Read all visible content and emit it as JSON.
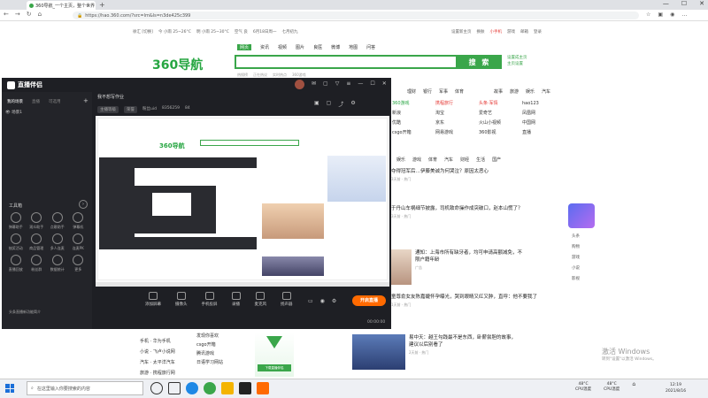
{
  "browser": {
    "tab_title": "360导航_一个主页，整个世界",
    "url": "https://hao.360.com/?src=lm&ls=n3de425c399",
    "window_controls": [
      "—",
      "☐",
      "✕"
    ]
  },
  "hao360": {
    "info_left": [
      "徐汇 [切换]",
      "今 小雨 25~26°C",
      "明 小雨 25~30°C",
      "空气 良",
      "6月18日周一",
      "七月初九"
    ],
    "info_right": [
      "设置新主页",
      "换肤",
      "小手机",
      "游戏",
      "邮箱",
      "登录"
    ],
    "logo": "360导航",
    "search_tabs": [
      "网页",
      "资讯",
      "视频",
      "图片",
      "良医",
      "微博",
      "地图",
      "问答"
    ],
    "search_button": "搜 索",
    "search_links": [
      "设置成主页",
      "主页设置"
    ],
    "hot_links": [
      "热搜榜",
      "正在热议",
      "实时热点",
      "360游戏"
    ],
    "top_nav_left": [
      "理财",
      "银行",
      "军事",
      "体育"
    ],
    "top_nav_right": [
      "故事",
      "旅游",
      "娱乐",
      "汽车"
    ],
    "site_grid": [
      "360游戏",
      "携程旅行",
      "头条·军情",
      "hao123",
      "新浪",
      "淘宝",
      "爱奇艺",
      "凤凰网",
      "优酷",
      "京东",
      "火山小视频",
      "中国网",
      "csgo开箱",
      "网易游戏",
      "360影视",
      "直播",
      "今日看点",
      "游戏·小游戏",
      "日语学习网站",
      "懂车帝"
    ],
    "side_r": [
      "4399",
      "网易游戏",
      "今日看点"
    ],
    "news_tabs": [
      "娱乐",
      "游戏",
      "体育",
      "汽车",
      "财经",
      "生活",
      "国产"
    ],
    "news": [
      {
        "title": "夺得冠军后…伊藤美诚为何哭泣？原因太恶心",
        "meta": "3天前 · 热门"
      },
      {
        "title": "于丹山车祸细节披露，司机致命操作成突破口，赵本山慌了？",
        "meta": "3天前 · 热门"
      },
      {
        "title": "通知：上海市所有缺牙者，均可申请高额减免，不限户籍年龄",
        "meta": "广告"
      },
      {
        "title": "童尊俞女友陈嘉婕怀孕曝光，哭到眼睛又红又肿，直呼：他不要我了",
        "meta": "1天前 · 热门"
      },
      {
        "title": "易中天：越王勾践最不是东西，卧薪尝胆的故事，建议以后别看了",
        "meta": "2天前 · 热门"
      }
    ],
    "sidebar_r": [
      "头条",
      "购物",
      "游戏",
      "小说",
      "影视"
    ],
    "bottom_left": [
      "手机 · 华为手机",
      "小说 · 飞卢小说网",
      "汽车 · 太平洋汽车",
      "旅游 · 携程旅行网"
    ],
    "bottom_col": [
      "发现你喜欢",
      "csgo开箱",
      "腾讯游戏",
      "日语学习网站",
      "二维码生成",
      "人体艺术摄影",
      "电脑壁纸"
    ],
    "promo_banner": "下载直播伴侣",
    "watermark": [
      "激活 Windows",
      "转到\"设置\"以激活 Windows。"
    ]
  },
  "app": {
    "title": "直播伴侣",
    "left_tabs": [
      "我的场景",
      "直播",
      "可选用"
    ],
    "scene_item": "场景1",
    "tools_header": "工具箱",
    "tools": [
      "弹幕助手",
      "观众助手",
      "点歌助手",
      "弹幕机",
      "抽奖活动",
      "商品管理",
      "多人连麦",
      "连麦PK",
      "直播回放",
      "粉丝群",
      "数据统计",
      "更多"
    ],
    "bottom_note": "头条直播新功能简介",
    "room_title": "我不想写作业",
    "room_tags": [
      "主播等级",
      "荣誉",
      "粉丝uid",
      "8356259",
      "84"
    ],
    "bottom_tools": [
      "添加屏幕",
      "摄像头",
      "手机投屏",
      "录播",
      "麦克风",
      "扬声器"
    ],
    "live_button": "开启直播",
    "timer": "00:00:00"
  },
  "taskbar": {
    "search_placeholder": "在这里输入你要搜索的内容",
    "weather1": [
      "48°C",
      "CPU温度"
    ],
    "weather2": [
      "48°C",
      "CPU温度"
    ],
    "time": "12:19",
    "date": "2021/8/16"
  }
}
